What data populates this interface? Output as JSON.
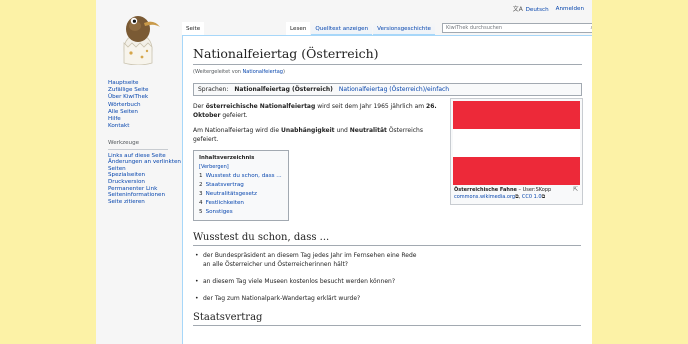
{
  "personal": {
    "language_label": "Deutsch",
    "login_label": "Anmelden"
  },
  "tabs": {
    "left": [
      "Seite"
    ],
    "right": [
      "Lesen",
      "Quelltext anzeigen",
      "Versionsgeschichte"
    ],
    "search_placeholder": "KiwiThek durchsuchen"
  },
  "nav": {
    "main": [
      "Hauptseite",
      "Zufällige Seite",
      "Über KiwiThek",
      "Wörterbuch",
      "Alle Seiten",
      "Hilfe",
      "Kontakt"
    ],
    "tools_heading": "Werkzeuge",
    "tools": [
      "Links auf diese Seite",
      "Änderungen an verlinkten Seiten",
      "Spezialseiten",
      "Druckversion",
      "Permanenter Link",
      "Seiteninformationen",
      "Seite zitieren"
    ]
  },
  "article": {
    "title": "Nationalfeiertag (Österreich)",
    "redirect_prefix": "(Weitergeleitet von ",
    "redirect_link": "Nationalfeiertag",
    "redirect_suffix": ")",
    "languages_label": "Sprachen:",
    "language_current": "Nationalfeiertag (Österreich)",
    "language_link": "Nationalfeiertag (Österreich)/einfach",
    "p1_a": "Der ",
    "p1_b": "österreichische Nationalfeiertag",
    "p1_c": " wird seit dem Jahr 1965 jährlich am ",
    "p1_d": "26. Oktober",
    "p1_e": " gefeiert.",
    "p2_a": "Am Nationalfeiertag wird die ",
    "p2_b": "Unabhängigkeit",
    "p2_c": " und ",
    "p2_d": "Neutralität",
    "p2_e": " Österreichs gefeiert."
  },
  "thumb": {
    "flag_colors": [
      "#ed2939",
      "#ffffff",
      "#ed2939"
    ],
    "caption_title": "Österreichische Fahne",
    "caption_author": " – User:SKopp",
    "caption_source": "commons.wikimedia.org",
    "caption_license": "CC0 1.0"
  },
  "toc": {
    "title": "Inhaltsverzeichnis",
    "toggle": "[Verbergen]",
    "entries": [
      {
        "num": "1",
        "label": "Wusstest du schon, dass ..."
      },
      {
        "num": "2",
        "label": "Staatsvertrag"
      },
      {
        "num": "3",
        "label": "Neutralitätsgesetz"
      },
      {
        "num": "4",
        "label": "Festlichkeiten"
      },
      {
        "num": "5",
        "label": "Sonstiges"
      }
    ]
  },
  "section1": {
    "heading": "Wusstest du schon, dass ...",
    "items": [
      "der Bundespräsident an diesem Tag jedes Jahr im Fernsehen eine Rede an alle Österreicher und Österreicherinnen hält?",
      "an diesem Tag viele Museen kostenlos besucht werden können?",
      "der Tag zum Nationalpark-Wandertag erklärt wurde?"
    ]
  },
  "section2": {
    "heading": "Staatsvertrag"
  }
}
